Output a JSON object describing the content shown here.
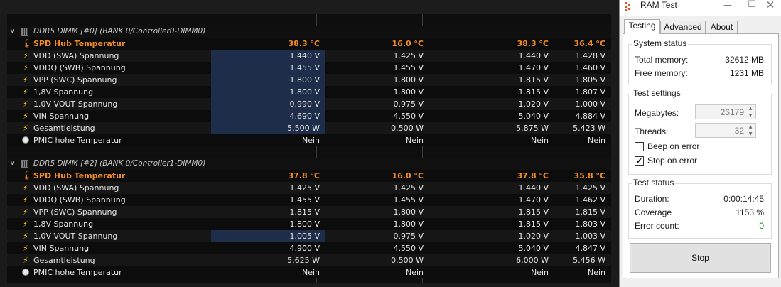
{
  "sensor_panel": {
    "groups": [
      {
        "title": "DDR5 DIMM [#0] (BANK 0/Controller0-DIMM0)",
        "rows": [
          {
            "icon": "thermometer-icon",
            "label": "SPD Hub Temperatur",
            "values": [
              "38.3 °C",
              "16.0 °C",
              "38.3 °C",
              "36.4 °C"
            ]
          },
          {
            "icon": "lightning-icon",
            "label": "VDD (SWA) Spannung",
            "values": [
              "1.440 V",
              "1.425 V",
              "1.440 V",
              "1.428 V"
            ]
          },
          {
            "icon": "lightning-icon",
            "label": "VDDQ (SWB) Spannung",
            "values": [
              "1.455 V",
              "1.455 V",
              "1.470 V",
              "1.460 V"
            ]
          },
          {
            "icon": "lightning-icon",
            "label": "VPP (SWC) Spannung",
            "values": [
              "1.800 V",
              "1.800 V",
              "1.815 V",
              "1.805 V"
            ]
          },
          {
            "icon": "lightning-icon",
            "label": "1,8V Spannung",
            "values": [
              "1.800 V",
              "1.800 V",
              "1.815 V",
              "1.807 V"
            ]
          },
          {
            "icon": "lightning-icon",
            "label": "1.0V VOUT Spannung",
            "values": [
              "0.990 V",
              "0.975 V",
              "1.020 V",
              "1.000 V"
            ]
          },
          {
            "icon": "lightning-icon",
            "label": "VIN Spannung",
            "values": [
              "4.690 V",
              "4.550 V",
              "5.040 V",
              "4.884 V"
            ]
          },
          {
            "icon": "lightning-icon",
            "label": "Gesamtleistung",
            "values": [
              "5.500 W",
              "0.500 W",
              "5.875 W",
              "5.423 W"
            ]
          },
          {
            "icon": "clock-icon",
            "label": "PMIC hohe Temperatur",
            "values": [
              "Nein",
              "Nein",
              "Nein",
              "Nein"
            ]
          }
        ]
      },
      {
        "title": "DDR5 DIMM [#2] (BANK 0/Controller1-DIMM0)",
        "rows": [
          {
            "icon": "thermometer-icon",
            "label": "SPD Hub Temperatur",
            "values": [
              "37.8 °C",
              "16.0 °C",
              "37.8 °C",
              "35.8 °C"
            ]
          },
          {
            "icon": "lightning-icon",
            "label": "VDD (SWA) Spannung",
            "values": [
              "1.425 V",
              "1.425 V",
              "1.440 V",
              "1.425 V"
            ]
          },
          {
            "icon": "lightning-icon",
            "label": "VDDQ (SWB) Spannung",
            "values": [
              "1.455 V",
              "1.455 V",
              "1.470 V",
              "1.462 V"
            ]
          },
          {
            "icon": "lightning-icon",
            "label": "VPP (SWC) Spannung",
            "values": [
              "1.815 V",
              "1.800 V",
              "1.815 V",
              "1.815 V"
            ]
          },
          {
            "icon": "lightning-icon",
            "label": "1,8V Spannung",
            "values": [
              "1.800 V",
              "1.800 V",
              "1.815 V",
              "1.803 V"
            ]
          },
          {
            "icon": "lightning-icon",
            "label": "1.0V VOUT Spannung",
            "values": [
              "1.005 V",
              "0.975 V",
              "1.020 V",
              "1.003 V"
            ]
          },
          {
            "icon": "lightning-icon",
            "label": "VIN Spannung",
            "values": [
              "4.900 V",
              "4.550 V",
              "5.040 V",
              "4.847 V"
            ]
          },
          {
            "icon": "lightning-icon",
            "label": "Gesamtleistung",
            "values": [
              "5.625 W",
              "0.500 W",
              "6.000 W",
              "5.456 W"
            ]
          },
          {
            "icon": "clock-icon",
            "label": "PMIC hohe Temperatur",
            "values": [
              "Nein",
              "Nein",
              "Nein",
              "Nein"
            ]
          }
        ]
      }
    ],
    "highlighted_current_cells": {
      "group_0_rows": [
        1,
        2,
        3,
        4,
        5,
        6,
        7
      ],
      "group_1_rows": [
        5
      ]
    },
    "colors": {
      "temperature_text": "#f08a24",
      "highlight_cell": "#1e2e4a",
      "row_background": "#0e0e0e"
    }
  },
  "ram_test": {
    "window_title": "RAM Test",
    "tabs": [
      {
        "label": "Testing",
        "active": true
      },
      {
        "label": "Advanced",
        "active": false
      },
      {
        "label": "About",
        "active": false
      }
    ],
    "system_status": {
      "title": "System status",
      "total_memory_label": "Total memory:",
      "total_memory_value": "32612 MB",
      "free_memory_label": "Free memory:",
      "free_memory_value": "1231 MB"
    },
    "test_settings": {
      "title": "Test settings",
      "megabytes_label": "Megabytes:",
      "megabytes_value": "26179",
      "threads_label": "Threads:",
      "threads_value": "32",
      "beep_on_error_label": "Beep on error",
      "beep_on_error_checked": false,
      "stop_on_error_label": "Stop on error",
      "stop_on_error_checked": true
    },
    "test_status": {
      "title": "Test status",
      "duration_label": "Duration:",
      "duration_value": "0:00:14:45",
      "coverage_label": "Coverage",
      "coverage_value": "1153 %",
      "error_count_label": "Error count:",
      "error_count_value": "0"
    },
    "stop_button_label": "Stop",
    "colors": {
      "error_count_ok": "#1b8a1b"
    }
  }
}
